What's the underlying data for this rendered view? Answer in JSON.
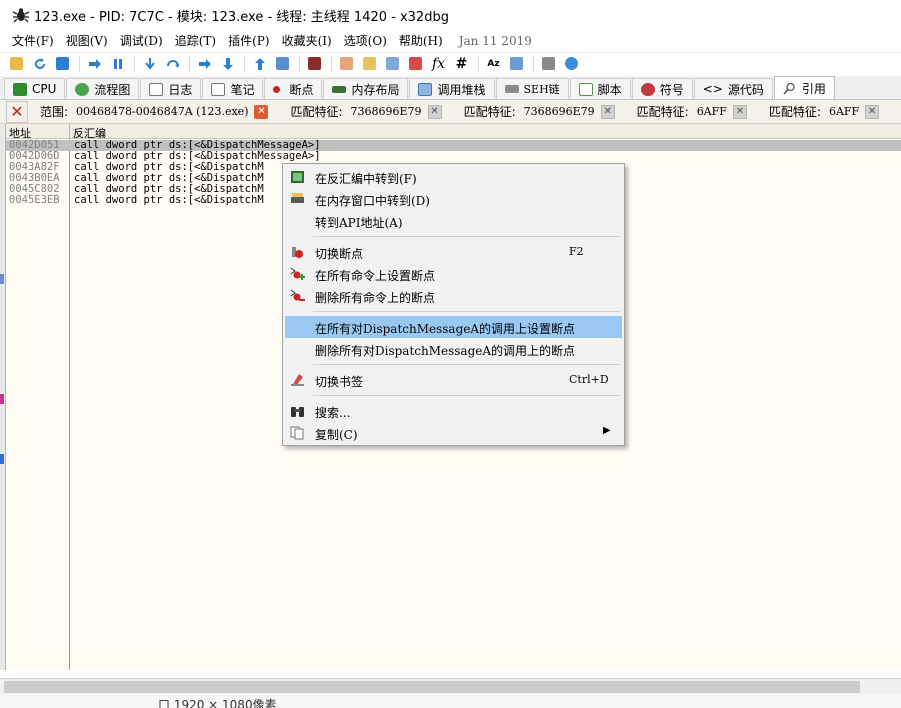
{
  "window": {
    "title": "123.exe - PID: 7C7C - 模块: 123.exe - 线程: 主线程 1420 - x32dbg"
  },
  "menubar": {
    "items": [
      "文件(F)",
      "视图(V)",
      "调试(D)",
      "追踪(T)",
      "插件(P)",
      "收藏夹(I)",
      "选项(O)",
      "帮助(H)"
    ],
    "date": "Jan 11 2019"
  },
  "toolbar": {
    "fx_label": "fx",
    "hash_label": "#",
    "az_label": "Az"
  },
  "tabs": [
    {
      "label": "CPU",
      "icon": "cpu-icon"
    },
    {
      "label": "流程图",
      "icon": "tree-icon"
    },
    {
      "label": "日志",
      "icon": "log-icon"
    },
    {
      "label": "笔记",
      "icon": "notes-icon"
    },
    {
      "label": "断点",
      "icon": "breakpoint-dot-icon"
    },
    {
      "label": "内存布局",
      "icon": "memory-icon"
    },
    {
      "label": "调用堆栈",
      "icon": "callstack-icon"
    },
    {
      "label": "SEH链",
      "icon": "seh-icon"
    },
    {
      "label": "脚本",
      "icon": "script-icon"
    },
    {
      "label": "符号",
      "icon": "symbol-icon"
    },
    {
      "label": "源代码",
      "icon": "source-code-icon"
    },
    {
      "label": "引用",
      "icon": "reference-search-icon"
    }
  ],
  "subtabs": {
    "range_label": "范围:",
    "range_value": "00468478-0046847A (123.exe)",
    "matches": [
      {
        "label": "匹配特征:",
        "value": "7368696E79"
      },
      {
        "label": "匹配特征:",
        "value": "7368696E79"
      },
      {
        "label": "匹配特征:",
        "value": "6AFF"
      },
      {
        "label": "匹配特征:",
        "value": "6AFF"
      }
    ]
  },
  "table": {
    "columns": [
      "地址",
      "反汇编"
    ],
    "rows": [
      {
        "addr": "0042D051",
        "dis": "call dword ptr ds:[<&DispatchMessageA>]"
      },
      {
        "addr": "0042D06D",
        "dis": "call dword ptr ds:[<&DispatchMessageA>]"
      },
      {
        "addr": "0043A82F",
        "dis": "call dword ptr ds:[<&DispatchM"
      },
      {
        "addr": "0043B0EA",
        "dis": "call dword ptr ds:[<&DispatchM"
      },
      {
        "addr": "0045C802",
        "dis": "call dword ptr ds:[<&DispatchM"
      },
      {
        "addr": "0045E3EB",
        "dis": "call dword ptr ds:[<&DispatchM"
      }
    ]
  },
  "context_menu": {
    "items": [
      {
        "label": "在反汇编中转到(F)",
        "icon": "disasm-goto-icon",
        "shortcut": ""
      },
      {
        "label": "在内存窗口中转到(D)",
        "icon": "memory-goto-icon",
        "shortcut": ""
      },
      {
        "label": "转到API地址(A)",
        "icon": "",
        "shortcut": ""
      },
      {
        "label": "切换断点",
        "icon": "toggle-breakpoint-icon",
        "shortcut": "F2"
      },
      {
        "label": "在所有命令上设置断点",
        "icon": "set-all-breakpoints-icon",
        "shortcut": ""
      },
      {
        "label": "删除所有命令上的断点",
        "icon": "remove-all-breakpoints-icon",
        "shortcut": ""
      },
      {
        "label": "在所有对DispatchMessageA的调用上设置断点",
        "icon": "",
        "shortcut": "",
        "highlighted": true
      },
      {
        "label": "删除所有对DispatchMessageA的调用上的断点",
        "icon": "",
        "shortcut": ""
      },
      {
        "label": "切换书签",
        "icon": "bookmark-icon",
        "shortcut": "Ctrl+D"
      },
      {
        "label": "搜索...",
        "icon": "binoculars-icon",
        "shortcut": ""
      },
      {
        "label": "复制(C)",
        "icon": "copy-icon",
        "shortcut": "",
        "submenu": true
      }
    ]
  },
  "statusbar": {
    "text": "口 1920 × 1080像素"
  },
  "colors": {
    "highlight": "#99c9f3",
    "table_bg": "#fffbf5",
    "selected_row": "#c0c0c0",
    "close_red": "#cc1f1f"
  }
}
